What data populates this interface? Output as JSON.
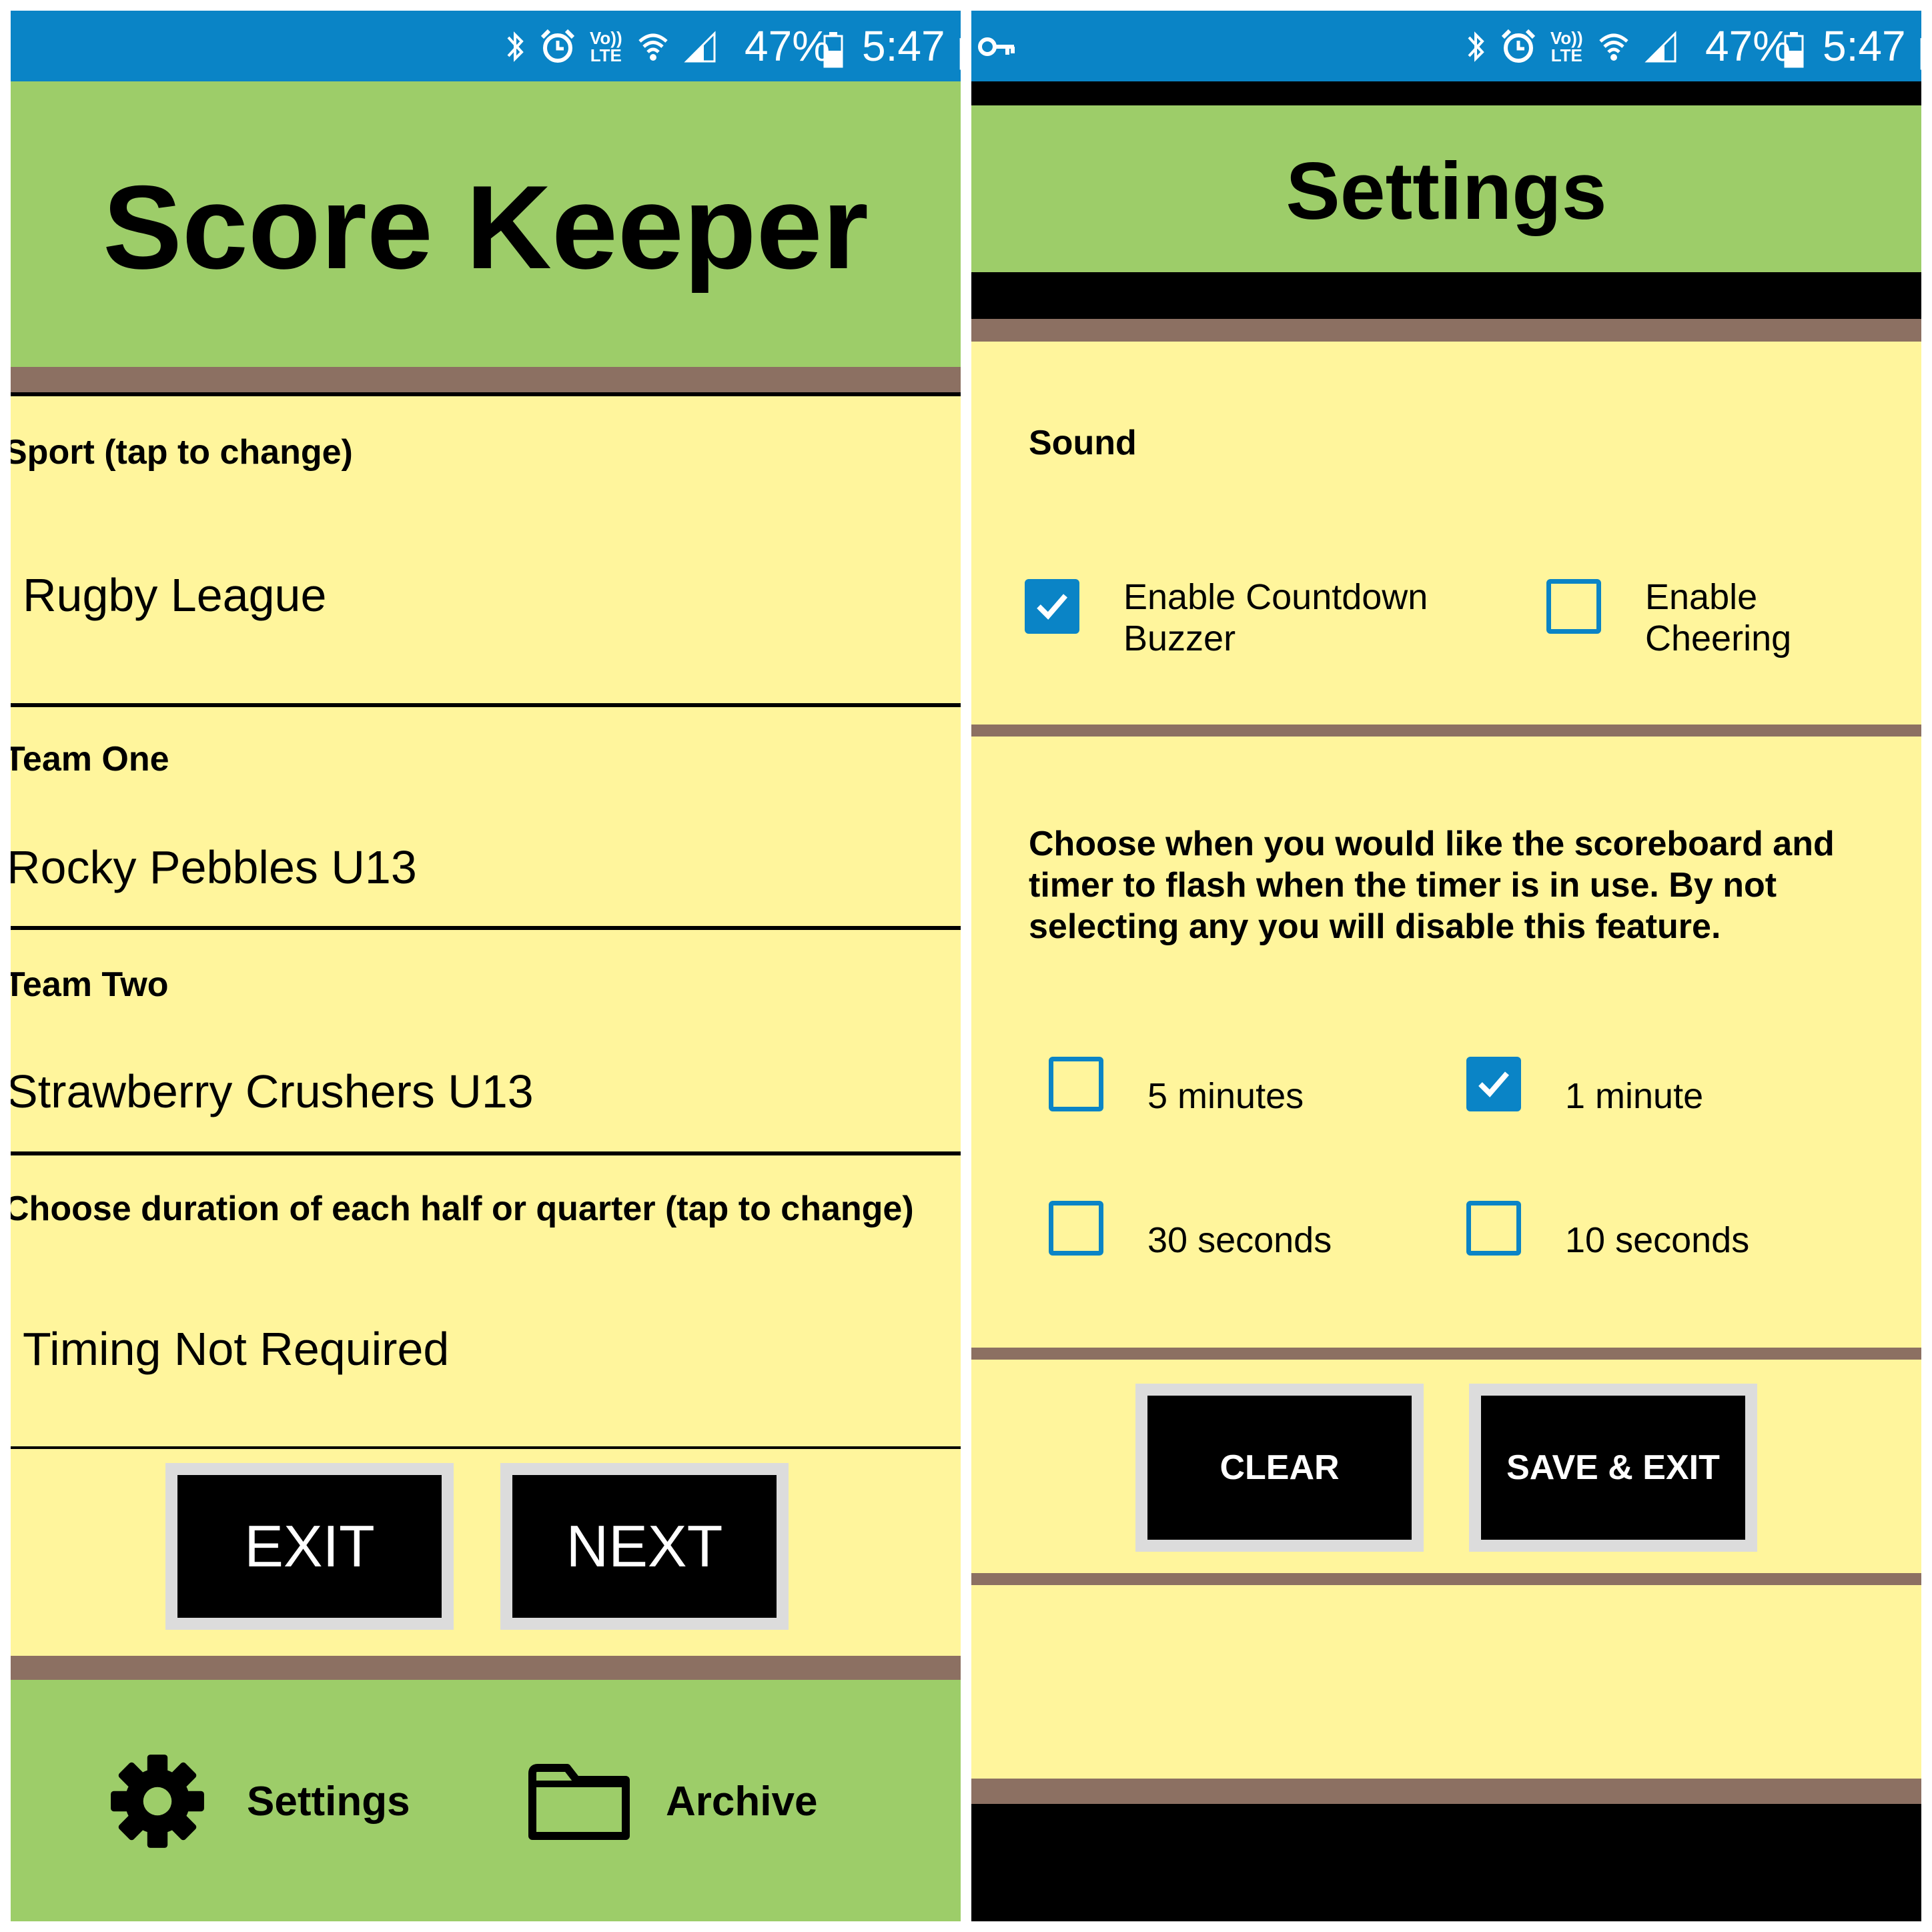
{
  "status_bar": {
    "battery": "47%",
    "time": "5:47",
    "time_cutoff": "p",
    "icons": [
      "bluetooth-icon",
      "alarm-icon",
      "volte-icon",
      "wifi-icon",
      "signal-icon",
      "battery-icon"
    ],
    "volte_top": "Vo))",
    "volte_bottom": "LTE"
  },
  "colors": {
    "status_bar": "#0a84c6",
    "header_green": "#9dcd69",
    "divider_brown": "#8c7062",
    "content_yellow": "#fff59c",
    "button_black": "#000000",
    "checkbox_blue": "#0a84c6"
  },
  "home": {
    "title": "Score Keeper",
    "sport": {
      "label": "Sport (tap to change)",
      "value": "Rugby League"
    },
    "team_one": {
      "label": "Team One",
      "value": "Rocky Pebbles U13"
    },
    "team_two": {
      "label": "Team Two",
      "value": "Strawberry Crushers U13"
    },
    "duration": {
      "label": "Choose duration of each half or quarter (tap to change)",
      "value": "Timing Not Required"
    },
    "buttons": {
      "exit": "EXIT",
      "next": "NEXT"
    },
    "nav": {
      "settings": "Settings",
      "archive": "Archive"
    }
  },
  "settings": {
    "title": "Settings",
    "sound": {
      "title": "Sound",
      "countdown_buzzer": {
        "label": "Enable Countdown Buzzer",
        "checked": true
      },
      "cheering": {
        "label": "Enable Cheering",
        "checked": false
      }
    },
    "flash": {
      "description": "Choose when you would like the scoreboard and timer to flash when the timer is in use.  By not selecting any you will disable this feature.",
      "options": [
        {
          "label": "5 minutes",
          "checked": false
        },
        {
          "label": "1 minute",
          "checked": true
        },
        {
          "label": "30 seconds",
          "checked": false
        },
        {
          "label": "10 seconds",
          "checked": false
        }
      ]
    },
    "buttons": {
      "clear": "CLEAR",
      "save_exit": "SAVE & EXIT"
    }
  }
}
